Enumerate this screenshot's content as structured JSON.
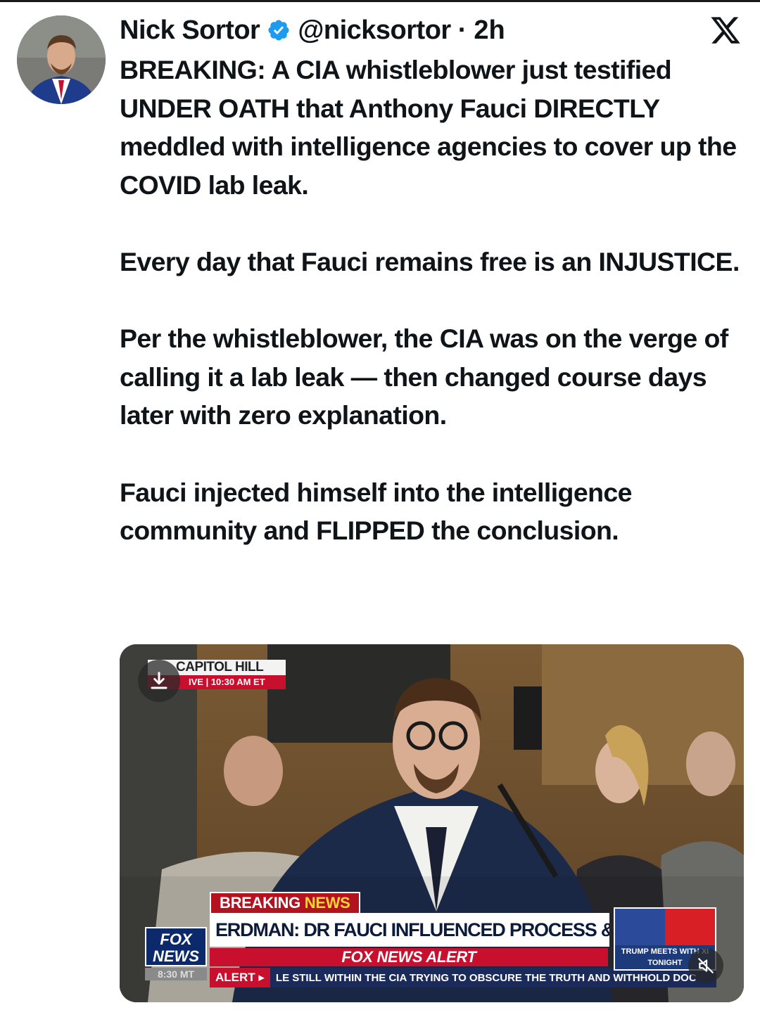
{
  "post": {
    "author_name": "Nick Sortor",
    "handle": "@nicksortor",
    "separator": "·",
    "time": "2h",
    "brand_icon": "x-logo-icon",
    "verified_icon": "verified-badge-icon",
    "accent_color": "#1d9bf0",
    "paragraphs": [
      "BREAKING: A CIA whistleblower just testified UNDER OATH that Anthony Fauci DIRECTLY meddled with intelligence agencies to cover up the COVID lab leak.",
      "Every day that Fauci remains free is an INJUSTICE.",
      "Per the whistleblower, the CIA was on the verge of calling it a lab leak — then changed course days later with zero explanation.",
      "Fauci injected himself into the intelligence community and FLIPPED the conclusion."
    ]
  },
  "media": {
    "live_bug_top": "CAPITOL HILL",
    "live_bug_bottom": "IVE  |  10:30 AM ET",
    "breaking_label": "BREAKING",
    "breaking_news": "NEWS",
    "headline": "ERDMAN: DR FAUCI INFLUENCED PROCESS & FINDINGS",
    "alert_bar": "FOX NEWS ALERT",
    "ticker_label": "ALERT ▸",
    "ticker_text": "LE STILL WITHIN THE CIA TRYING TO OBSCURE THE TRUTH AND WITHHOLD DOC",
    "network_logo_line1": "FOX",
    "network_logo_line2": "NEWS",
    "network_time": "8:30 MT",
    "promo_line1": "TRUMP MEETS WITH XI",
    "promo_line2": "TONIGHT",
    "download_icon": "download-icon",
    "mute_icon": "mute-icon"
  }
}
